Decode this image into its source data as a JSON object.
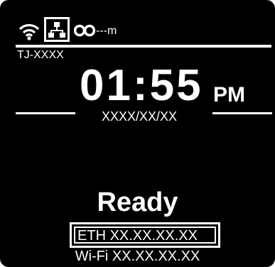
{
  "status_bar": {
    "icons": [
      "wifi-icon",
      "ethernet-icon",
      "ribbon-icon"
    ],
    "ribbon_remaining": "---m"
  },
  "printer_name": "TJ-XXXX",
  "clock": {
    "time": "01:55",
    "ampm": "PM",
    "date": "XXXX/XX/XX"
  },
  "status": {
    "text": "Ready"
  },
  "network": {
    "eth_address": "ETH XX.XX.XX.XX",
    "wifi_address": "Wi-Fi XX.XX.XX.XX"
  },
  "colors": {
    "background": "#000000",
    "foreground": "#ffffff"
  }
}
